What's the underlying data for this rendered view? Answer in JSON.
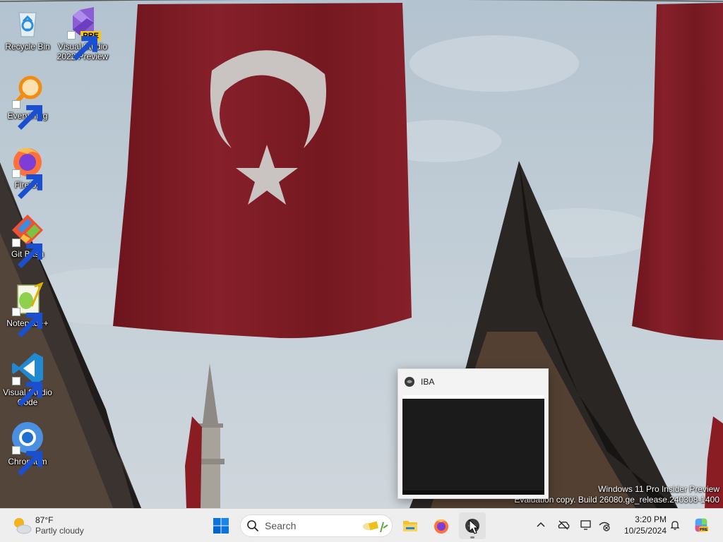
{
  "desktop": {
    "icons": [
      {
        "label": "Recycle Bin",
        "icon": "recycle-bin-icon"
      },
      {
        "label": "Visual Studio 2022 Preview",
        "icon": "visual-studio-icon",
        "badge": "PRE"
      },
      {
        "label": "Everything",
        "icon": "everything-search-icon"
      },
      {
        "label": "Firefox",
        "icon": "firefox-icon"
      },
      {
        "label": "Git Bash",
        "icon": "git-bash-icon"
      },
      {
        "label": "Notepad++",
        "icon": "notepadpp-icon"
      },
      {
        "label": "Visual Studio Code",
        "icon": "vscode-icon"
      },
      {
        "label": "Chromium",
        "icon": "chromium-icon"
      }
    ],
    "wallpaper": "turkish-flags-mosque-wallpaper"
  },
  "watermark": {
    "line1": "Windows 11 Pro Insider Preview",
    "line2": "Evaluation copy. Build 26080.ge_release.240308-1400"
  },
  "popup": {
    "title": "IBA",
    "icon": "iba-app-icon"
  },
  "taskbar": {
    "weather": {
      "temp": "87°F",
      "condition": "Partly cloudy"
    },
    "search": {
      "label": "Search"
    },
    "apps": [
      {
        "name": "start",
        "icon": "windows-start-icon"
      },
      {
        "name": "file-explorer",
        "icon": "folder-icon"
      },
      {
        "name": "firefox",
        "icon": "firefox-icon"
      },
      {
        "name": "iba",
        "icon": "iba-app-icon",
        "active": true
      }
    ],
    "tray": [
      "chevron-up-icon",
      "onedrive-offline-icon",
      "display-icon",
      "network-disconnected-icon"
    ],
    "clock": {
      "time": "3:20 PM",
      "date": "10/25/2024"
    }
  },
  "colors": {
    "flag_red": "#7e1a22",
    "sky": "#b9c6cf",
    "taskbar": "#eeeeee",
    "accent": "#0067c0"
  }
}
